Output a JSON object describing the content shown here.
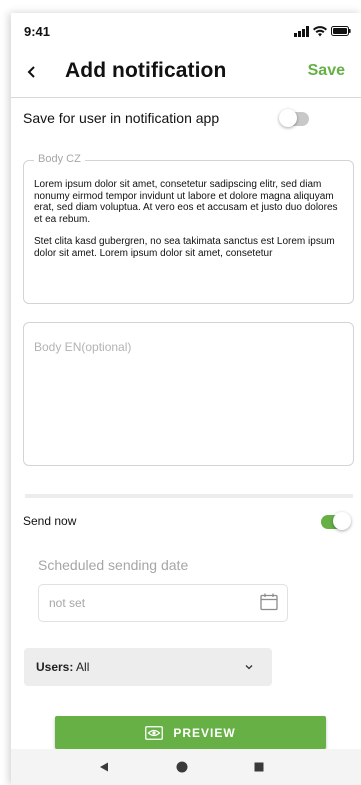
{
  "status_bar": {
    "time": "9:41",
    "icons": [
      "signal-icon",
      "wifi-icon",
      "battery-icon"
    ]
  },
  "header": {
    "title": "Add notification",
    "save_label": "Save",
    "back_icon": "chevron-left-icon"
  },
  "save_for_user": {
    "label": "Save for user in notification app",
    "enabled": false
  },
  "body_cz": {
    "label": "Body CZ",
    "paragraphs": [
      "Lorem ipsum dolor sit amet, consetetur sadipscing elitr, sed diam nonumy eirmod tempor invidunt ut labore et dolore magna aliquyam erat, sed diam voluptua. At vero eos et accusam et justo duo dolores et ea rebum.",
      "Stet clita kasd gubergren, no sea takimata sanctus est Lorem ipsum dolor sit amet. Lorem ipsum dolor sit amet, consetetur"
    ]
  },
  "body_en": {
    "placeholder": "Body EN(optional)",
    "value": ""
  },
  "send_now": {
    "label": "Send now",
    "enabled": true
  },
  "schedule": {
    "label": "Scheduled sending date",
    "value": "not set",
    "icon": "calendar-icon"
  },
  "users": {
    "label": "Users:",
    "value": "All",
    "icon": "chevron-down-icon"
  },
  "preview": {
    "label": "PREVIEW",
    "icon": "eye-icon"
  },
  "colors": {
    "accent": "#66b046",
    "toggle_off": "#c8c8c8",
    "muted_text": "#a6a6a6",
    "select_bg": "#ededed"
  },
  "android_nav": {
    "back_icon": "triangle-back-icon",
    "home_icon": "circle-home-icon",
    "recent_icon": "square-recent-icon"
  }
}
